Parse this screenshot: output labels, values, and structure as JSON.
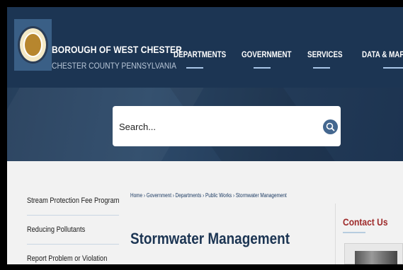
{
  "header": {
    "brand_title": "BOROUGH OF WEST CHESTER",
    "brand_subtitle": "CHESTER COUNTY PENNSYLVANIA",
    "nav": [
      {
        "label": "DEPARTMENTS"
      },
      {
        "label": "GOVERNMENT"
      },
      {
        "label": "SERVICES"
      },
      {
        "label": "DATA & MAP S"
      }
    ]
  },
  "search": {
    "placeholder": "Search...",
    "icon": "search-icon"
  },
  "sidebar": {
    "items": [
      {
        "label": "Stream Protection Fee Program"
      },
      {
        "label": "Reducing Pollutants"
      },
      {
        "label": "Report Problem or Violation"
      }
    ]
  },
  "main": {
    "breadcrumb": "Home › Government › Departments › Public Works › Stormwater Management",
    "title": "Stormwater Management"
  },
  "aside": {
    "contact_title": "Contact Us"
  },
  "colors": {
    "header_bg": "#1c3553",
    "accent_red": "#9e2a2a",
    "search_button": "#44678f"
  }
}
